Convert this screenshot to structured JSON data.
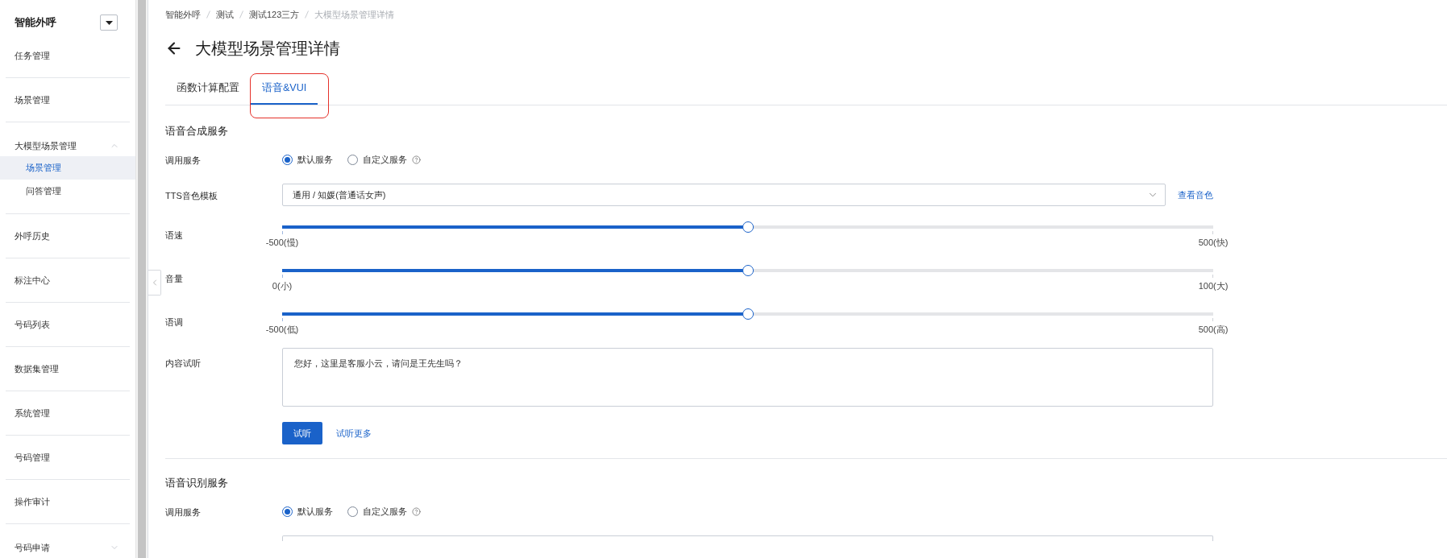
{
  "sidebar": {
    "title": "智能外呼",
    "items": [
      {
        "kind": "link",
        "label": "任务管理",
        "selected": false
      },
      {
        "kind": "link",
        "label": "场景管理",
        "selected": false
      },
      {
        "kind": "group",
        "label": "大模型场景管理",
        "selected": false,
        "expanded": true,
        "children": [
          {
            "label": "场景管理",
            "selected": true
          },
          {
            "label": "问答管理",
            "selected": false
          }
        ]
      },
      {
        "kind": "link",
        "label": "外呼历史",
        "selected": false
      },
      {
        "kind": "link",
        "label": "标注中心",
        "selected": false
      },
      {
        "kind": "link",
        "label": "号码列表",
        "selected": false
      },
      {
        "kind": "link",
        "label": "数据集管理",
        "selected": false
      },
      {
        "kind": "link",
        "label": "系统管理",
        "selected": false
      },
      {
        "kind": "link",
        "label": "号码管理",
        "selected": false
      },
      {
        "kind": "link",
        "label": "操作审计",
        "selected": false
      },
      {
        "kind": "group",
        "label": "号码申请",
        "selected": false,
        "expanded": false
      }
    ]
  },
  "breadcrumb": [
    {
      "label": "智能外呼",
      "current": false
    },
    {
      "label": "测试",
      "current": false
    },
    {
      "label": "测试123三方",
      "current": false
    },
    {
      "label": "大模型场景管理详情",
      "current": true
    }
  ],
  "page": {
    "title": "大模型场景管理详情"
  },
  "tabs": [
    {
      "label": "函数计算配置",
      "selected": false,
      "highlighted": false
    },
    {
      "label": "语音&VUI",
      "selected": true,
      "highlighted": true
    }
  ],
  "sections": [
    {
      "title": "语音合成服务",
      "rows": [
        {
          "kind": "radio",
          "label": "调用服务",
          "options": [
            {
              "label": "默认服务",
              "selected": true,
              "help": false
            },
            {
              "label": "自定义服务",
              "selected": false,
              "help": true
            }
          ]
        },
        {
          "kind": "select",
          "label": "TTS音色模板",
          "value": "通用 / 知媛(普通话女声)",
          "link": "查看音色"
        },
        {
          "kind": "slider",
          "label": "语速",
          "level": 0.5,
          "min_label": "-500(慢)",
          "max_label": "500(快)"
        },
        {
          "kind": "slider",
          "label": "音量",
          "level": 0.5,
          "min_label": "0(小)",
          "max_label": "100(大)"
        },
        {
          "kind": "slider",
          "label": "语调",
          "level": 0.5,
          "min_label": "-500(低)",
          "max_label": "500(高)"
        },
        {
          "kind": "textarea",
          "label": "内容试听",
          "value": "您好，这里是客服小云，请问是王先生吗？"
        },
        {
          "kind": "actions",
          "button": "试听",
          "link": "试听更多"
        }
      ]
    },
    {
      "title": "语音识别服务",
      "rows": [
        {
          "kind": "radio",
          "label": "调用服务",
          "options": [
            {
              "label": "默认服务",
              "selected": true,
              "help": false
            },
            {
              "label": "自定义服务",
              "selected": false,
              "help": true
            }
          ]
        },
        {
          "kind": "field"
        }
      ]
    }
  ]
}
